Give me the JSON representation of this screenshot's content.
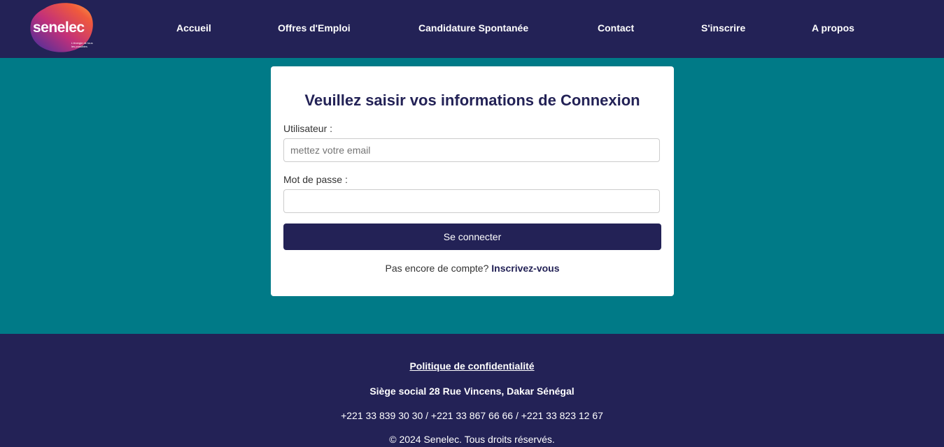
{
  "logo": {
    "name": "senelec",
    "tagline": "L'énergie de tous les possibles"
  },
  "nav": {
    "items": [
      {
        "label": "Accueil"
      },
      {
        "label": "Offres d'Emploi"
      },
      {
        "label": "Candidature Spontanée"
      },
      {
        "label": "Contact"
      },
      {
        "label": "S'inscrire"
      },
      {
        "label": "A propos"
      }
    ]
  },
  "login": {
    "title": "Veuillez saisir vos informations de Connexion",
    "user_label": "Utilisateur :",
    "user_placeholder": "mettez votre email",
    "user_value": "",
    "password_label": "Mot de passe :",
    "password_value": "",
    "submit_label": "Se connecter",
    "signup_prompt": "Pas encore de compte?",
    "signup_link": "Inscrivez-vous"
  },
  "footer": {
    "privacy_link": "Politique de confidentialité",
    "address": "Siège social 28 Rue Vincens, Dakar Sénégal",
    "phones": "+221 33 839 30 30 / +221 33 867 66 66 / +221 33 823 12 67",
    "copyright": "© 2024 Senelec. Tous droits réservés."
  },
  "colors": {
    "navy": "#232256",
    "teal": "#007a87",
    "white": "#ffffff"
  }
}
